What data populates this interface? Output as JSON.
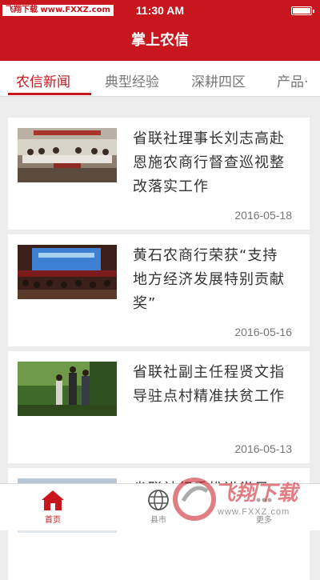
{
  "status_bar": {
    "watermark_tag": "飞翔下载 www.FXXZ.com",
    "time": "11:30 AM"
  },
  "header": {
    "title": "掌上农信"
  },
  "tabs": [
    {
      "label": "农信新闻",
      "active": true
    },
    {
      "label": "典型经验",
      "active": false
    },
    {
      "label": "深耕四区",
      "active": false
    },
    {
      "label": "产品·",
      "active": false
    }
  ],
  "news": [
    {
      "title": "省联社理事长刘志高赴恩施农商行督查巡视整改落实工作",
      "date": "2016-05-18",
      "thumb": "meeting-room"
    },
    {
      "title": "黄石农商行荣获“支持地方经济发展特别贡献奖”",
      "date": "2016-05-16",
      "thumb": "auditorium-stage"
    },
    {
      "title": "省联社副主任程贤文指导驻点村精准扶贫工作",
      "date": "2016-05-13",
      "thumb": "outdoor-forest"
    },
    {
      "title": "省联社纪委推进党风",
      "date": "",
      "thumb": "partial"
    }
  ],
  "bottom_nav": [
    {
      "label": "首页",
      "icon": "home-icon",
      "active": true
    },
    {
      "label": "县市",
      "icon": "globe-icon",
      "active": false
    },
    {
      "label": "更多",
      "icon": "more-icon",
      "active": false
    }
  ],
  "watermark": {
    "brand": "飞翔下载",
    "url": "www.FXXZ.com"
  },
  "colors": {
    "brand_red": "#c8161e",
    "bg": "#ededed"
  }
}
